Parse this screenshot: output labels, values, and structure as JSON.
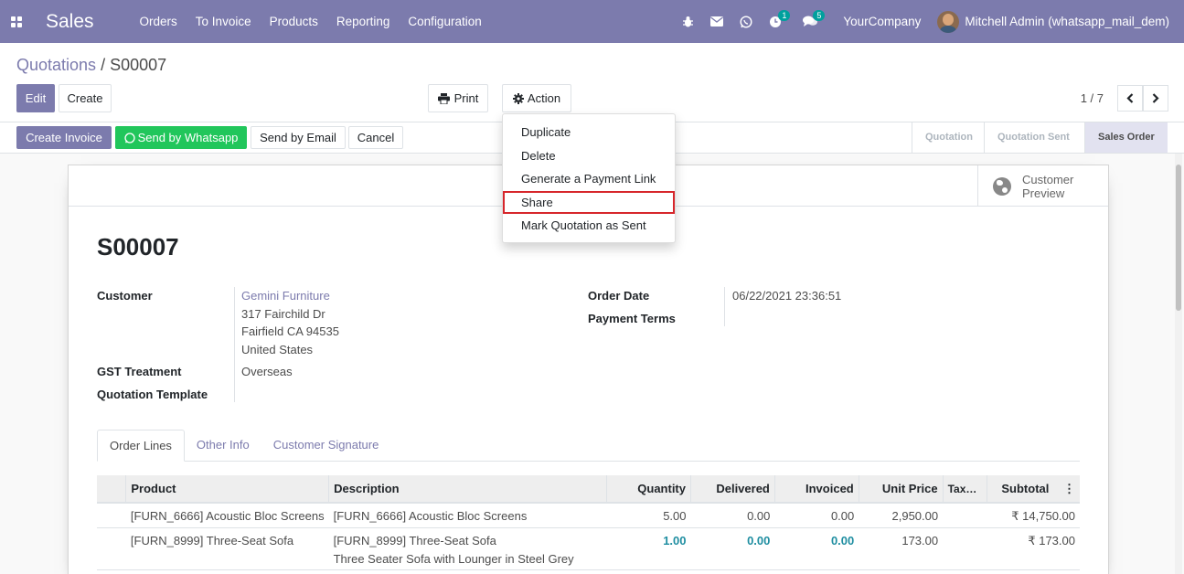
{
  "navbar": {
    "brand": "Sales",
    "menu": [
      "Orders",
      "To Invoice",
      "Products",
      "Reporting",
      "Configuration"
    ],
    "activity_badge": "1",
    "messages_badge": "5",
    "company": "YourCompany",
    "user": "Mitchell Admin (whatsapp_mail_dem)"
  },
  "breadcrumb": {
    "parent": "Quotations",
    "separator": "/",
    "current": "S00007"
  },
  "toolbar": {
    "edit": "Edit",
    "create": "Create",
    "print": "Print",
    "action": "Action",
    "pager": "1 / 7"
  },
  "action_menu": {
    "items": [
      "Duplicate",
      "Delete",
      "Generate a Payment Link",
      "Share",
      "Mark Quotation as Sent"
    ],
    "highlighted_index": 3
  },
  "status_buttons": {
    "create_invoice": "Create Invoice",
    "send_whatsapp": "Send by Whatsapp",
    "send_email": "Send by Email",
    "cancel": "Cancel"
  },
  "stages": [
    "Quotation",
    "Quotation Sent",
    "Sales Order"
  ],
  "active_stage": "Sales Order",
  "preview": {
    "line1": "Customer",
    "line2": "Preview"
  },
  "record": {
    "name": "S00007",
    "customer_label": "Customer",
    "customer_name": "Gemini Furniture",
    "address_line1": "317 Fairchild Dr",
    "address_line2": "Fairfield CA 94535",
    "address_line3": "United States",
    "gst_label": "GST Treatment",
    "gst_value": "Overseas",
    "template_label": "Quotation Template",
    "order_date_label": "Order Date",
    "order_date": "06/22/2021 23:36:51",
    "payment_terms_label": "Payment Terms"
  },
  "tabs": [
    "Order Lines",
    "Other Info",
    "Customer Signature"
  ],
  "lines": {
    "headers": [
      "Product",
      "Description",
      "Quantity",
      "Delivered",
      "Invoiced",
      "Unit Price",
      "Tax…",
      "Subtotal"
    ],
    "rows": [
      {
        "product": "[FURN_6666] Acoustic Bloc Screens",
        "description": "[FURN_6666] Acoustic Bloc Screens",
        "description2": "",
        "quantity": "5.00",
        "delivered": "0.00",
        "invoiced": "0.00",
        "unit_price": "2,950.00",
        "tax": "",
        "subtotal": "₹ 14,750.00"
      },
      {
        "product": "[FURN_8999] Three-Seat Sofa",
        "description": "[FURN_8999] Three-Seat Sofa",
        "description2": "Three Seater Sofa with Lounger in Steel Grey",
        "quantity": "1.00",
        "delivered": "0.00",
        "invoiced": "0.00",
        "unit_price": "173.00",
        "tax": "",
        "subtotal": "₹ 173.00"
      }
    ]
  },
  "colors": {
    "brand": "#7c7bad",
    "whatsapp": "#21c65b",
    "highlight_border": "#d7262b"
  }
}
